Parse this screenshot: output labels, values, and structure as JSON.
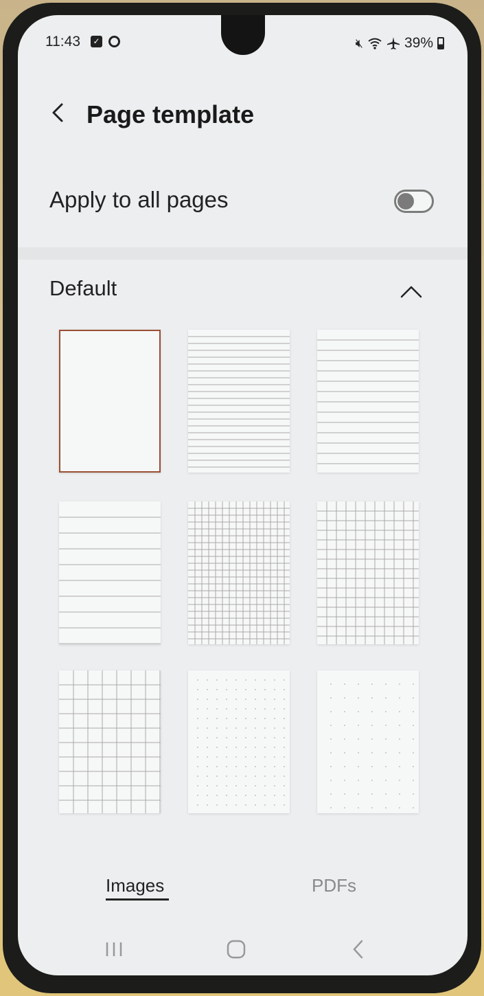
{
  "status_bar": {
    "time": "11:43",
    "battery": "39%",
    "icons": [
      "checkbox-notification-icon",
      "circle-notification-icon",
      "mute-icon",
      "wifi-icon",
      "airplane-mode-icon",
      "battery-icon"
    ]
  },
  "header": {
    "title": "Page template",
    "back_icon": "chevron-left-icon"
  },
  "apply_all": {
    "label": "Apply to all pages",
    "enabled": false
  },
  "section": {
    "title": "Default",
    "expanded": true
  },
  "templates": [
    {
      "style": "blank",
      "selected": true
    },
    {
      "style": "narrow-lines",
      "selected": false
    },
    {
      "style": "medium-lines",
      "selected": false
    },
    {
      "style": "wide-lines",
      "selected": false
    },
    {
      "style": "small-grid",
      "selected": false
    },
    {
      "style": "medium-grid",
      "selected": false
    },
    {
      "style": "large-grid",
      "selected": false
    },
    {
      "style": "small-dots",
      "selected": false
    },
    {
      "style": "large-dots",
      "selected": false
    }
  ],
  "tabs": [
    {
      "label": "Images",
      "active": true
    },
    {
      "label": "PDFs",
      "active": false
    }
  ],
  "nav": [
    "recent-apps-icon",
    "home-icon",
    "back-icon"
  ],
  "colors": {
    "selected_border": "#9a4e33",
    "toggle_off": "#7b7b7b",
    "background": "#eceeef"
  }
}
